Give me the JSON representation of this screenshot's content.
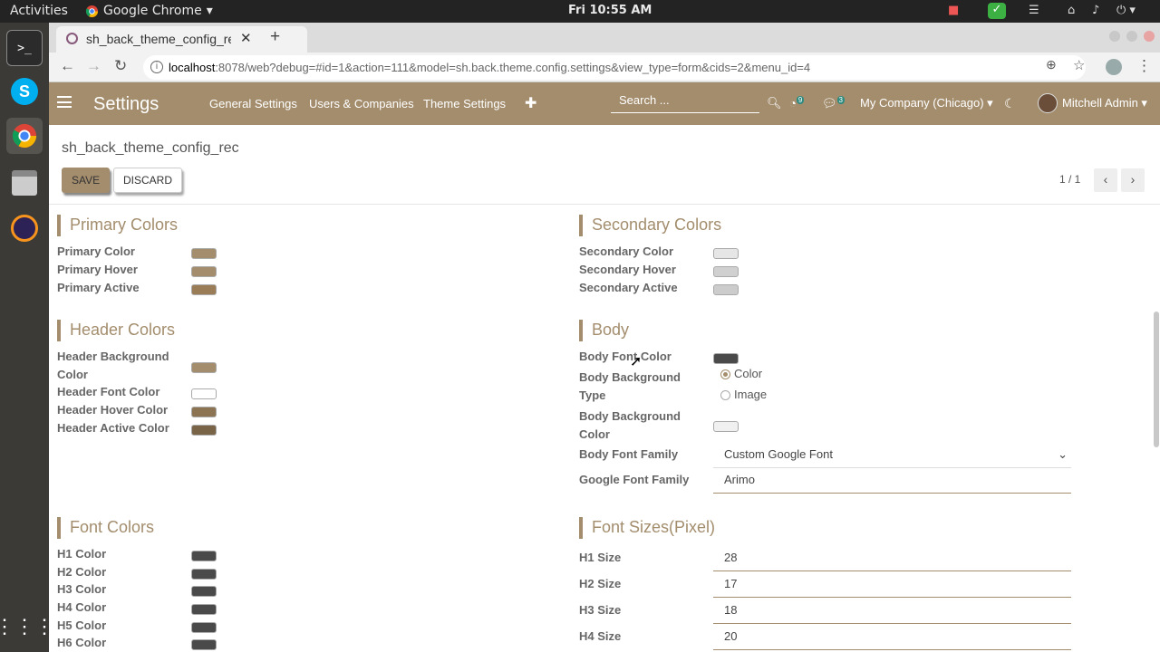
{
  "system": {
    "activities": "Activities",
    "app_name": "Google Chrome",
    "clock": "Fri 10:55 AM"
  },
  "browser": {
    "tab_title": "sh_back_theme_config_re",
    "url_host": "localhost",
    "url_rest": ":8078/web?debug=#id=1&action=111&model=sh.back.theme.config.settings&view_type=form&cids=2&menu_id=4"
  },
  "odoo_nav": {
    "brand": "Settings",
    "menus": [
      "General Settings",
      "Users & Companies",
      "Theme Settings"
    ],
    "search_placeholder": "Search ...",
    "activity_count": "9",
    "message_count": "3",
    "company": "My Company (Chicago)",
    "user": "Mitchell Admin"
  },
  "control_panel": {
    "breadcrumb": "sh_back_theme_config_rec",
    "save_label": "SAVE",
    "discard_label": "DISCARD",
    "pager": "1 / 1"
  },
  "form": {
    "primary": {
      "title": "Primary Colors",
      "fields": [
        {
          "label": "Primary Color",
          "color": "#a38d6d"
        },
        {
          "label": "Primary Hover",
          "color": "#a38d6d"
        },
        {
          "label": "Primary Active",
          "color": "#9a7d57"
        }
      ]
    },
    "secondary": {
      "title": "Secondary Colors",
      "fields": [
        {
          "label": "Secondary Color",
          "color": "#e6e6e6"
        },
        {
          "label": "Secondary Hover",
          "color": "#d0d0d0"
        },
        {
          "label": "Secondary Active",
          "color": "#cccccc"
        }
      ]
    },
    "header": {
      "title": "Header Colors",
      "fields": [
        {
          "label": "Header Background Color",
          "color": "#a38d6d"
        },
        {
          "label": "Header Font Color",
          "color": "#ffffff"
        },
        {
          "label": "Header Hover Color",
          "color": "#8c7352"
        },
        {
          "label": "Header Active Color",
          "color": "#7a6448"
        }
      ]
    },
    "body": {
      "title": "Body",
      "font_color_label": "Body Font Color",
      "font_color": "#4a4a4a",
      "bg_type_label": "Body Background Type",
      "bg_type_options": [
        "Color",
        "Image"
      ],
      "bg_type_selected": "Color",
      "bg_color_label": "Body Background Color",
      "bg_color": "#f0f0f0",
      "font_family_label": "Body Font Family",
      "font_family_value": "Custom Google Font",
      "google_font_label": "Google Font Family",
      "google_font_value": "Arimo"
    },
    "font_colors": {
      "title": "Font Colors",
      "fields": [
        {
          "label": "H1 Color",
          "color": "#4a4a4a"
        },
        {
          "label": "H2 Color",
          "color": "#4a4a4a"
        },
        {
          "label": "H3 Color",
          "color": "#4a4a4a"
        },
        {
          "label": "H4 Color",
          "color": "#4a4a4a"
        },
        {
          "label": "H5 Color",
          "color": "#4a4a4a"
        },
        {
          "label": "H6 Color",
          "color": "#4a4a4a"
        }
      ]
    },
    "font_sizes": {
      "title": "Font Sizes(Pixel)",
      "fields": [
        {
          "label": "H1 Size",
          "value": "28"
        },
        {
          "label": "H2 Size",
          "value": "17"
        },
        {
          "label": "H3 Size",
          "value": "18"
        },
        {
          "label": "H4 Size",
          "value": "20"
        }
      ]
    }
  }
}
